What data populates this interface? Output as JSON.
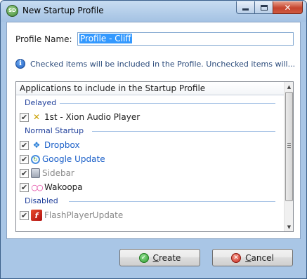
{
  "window": {
    "title": "New Startup Profile",
    "icon_text": "SD",
    "close_glyph": "✕"
  },
  "profile": {
    "label": "Profile Name:",
    "value": "Profile - Cliff"
  },
  "info": {
    "text": "Checked items will be included in the Profile. Unchecked items will..."
  },
  "list": {
    "header": "Applications to include in the Startup Profile",
    "groups": [
      {
        "name": "Delayed",
        "items": [
          {
            "label": "1st - Xion Audio Player",
            "checked": true,
            "icon": "xion-icon",
            "color": "#1e1e1e"
          }
        ]
      },
      {
        "name": "Normal Startup",
        "items": [
          {
            "label": "Dropbox",
            "checked": true,
            "icon": "dropbox-icon",
            "color": "#1a5fc8"
          },
          {
            "label": "Google Update",
            "checked": true,
            "icon": "google-update-icon",
            "color": "#1a5fc8"
          },
          {
            "label": "Sidebar",
            "checked": true,
            "icon": "sidebar-icon",
            "color": "#8a8a8a"
          },
          {
            "label": "Wakoopa",
            "checked": true,
            "icon": "wakoopa-icon",
            "color": "#1e1e1e"
          }
        ]
      },
      {
        "name": "Disabled",
        "items": [
          {
            "label": "FlashPlayerUpdate",
            "checked": true,
            "icon": "flash-icon",
            "color": "#8a8a8a"
          }
        ]
      }
    ]
  },
  "buttons": {
    "create_first": "C",
    "create_rest": "reate",
    "cancel_first": "C",
    "cancel_rest": "ancel"
  },
  "colors": {
    "accent": "#3399ff",
    "group_header": "#1e3e9a",
    "link_blue": "#1a5fc8",
    "disabled_gray": "#8a8a8a"
  }
}
